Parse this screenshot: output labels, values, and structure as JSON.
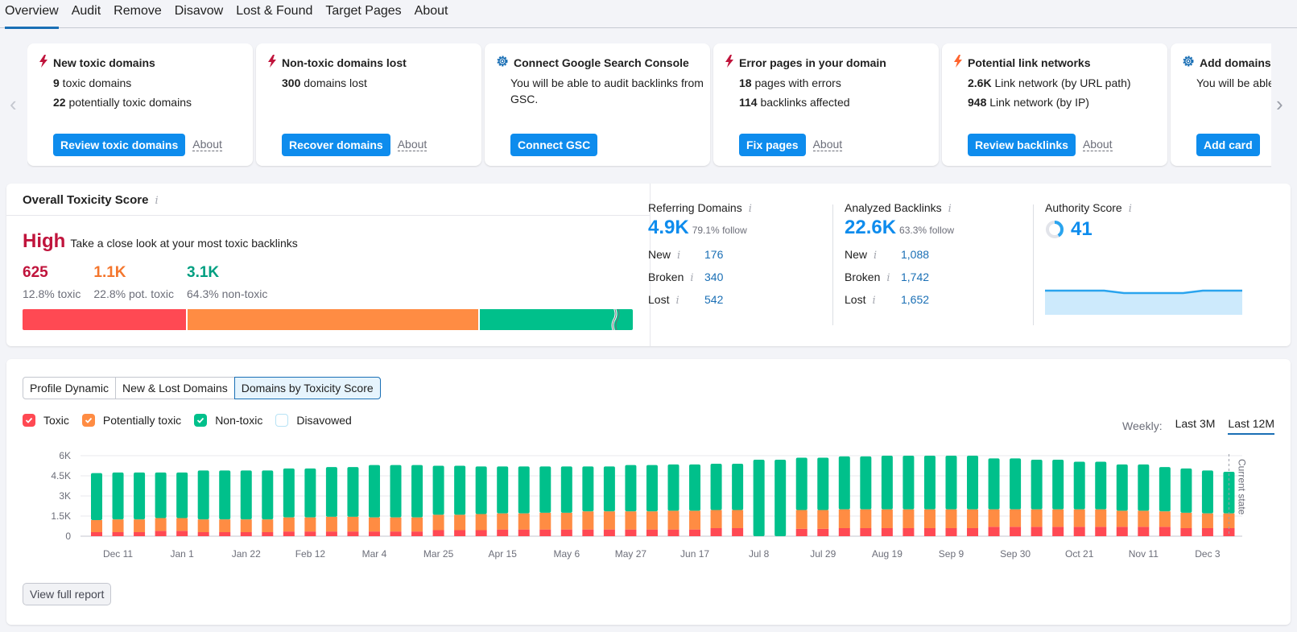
{
  "tabs": [
    {
      "label": "Overview",
      "active": true
    },
    {
      "label": "Audit"
    },
    {
      "label": "Remove"
    },
    {
      "label": "Disavow"
    },
    {
      "label": "Lost & Found"
    },
    {
      "label": "Target Pages"
    },
    {
      "label": "About"
    }
  ],
  "cards": [
    {
      "icon": "bolt",
      "icon_color": "#c0143c",
      "title": "New toxic domains",
      "lines": [
        {
          "num": "9",
          "text": " toxic domains"
        },
        {
          "num": "22",
          "text": " potentially toxic domains"
        }
      ],
      "button": "Review toxic domains",
      "about": "About"
    },
    {
      "icon": "bolt",
      "icon_color": "#c0143c",
      "title": "Non-toxic domains lost",
      "lines": [
        {
          "num": "300",
          "text": " domains lost"
        }
      ],
      "button": "Recover domains",
      "about": "About"
    },
    {
      "icon": "gear",
      "icon_color": "#1a6fb5",
      "title": "Connect Google Search Console",
      "desc": "You will be able to audit backlinks from GSC.",
      "button": "Connect GSC"
    },
    {
      "icon": "bolt",
      "icon_color": "#c0143c",
      "title": "Error pages in your domain",
      "lines": [
        {
          "num": "18",
          "text": " pages with errors"
        },
        {
          "num": "114",
          "text": " backlinks affected"
        }
      ],
      "button": "Fix pages",
      "about": "About"
    },
    {
      "icon": "bolt",
      "icon_color": "#ff642d",
      "title": "Potential link networks",
      "lines": [
        {
          "num": "2.6K",
          "text": " Link network (by URL path)"
        },
        {
          "num": "948",
          "text": " Link network (by IP)"
        }
      ],
      "button": "Review backlinks",
      "about": "About"
    },
    {
      "icon": "gear",
      "icon_color": "#1a6fb5",
      "title": "Add domains",
      "desc": "You will be able to add domains",
      "button": "Add card"
    }
  ],
  "toxicity": {
    "title": "Overall Toxicity Score",
    "info": "i",
    "level": "High",
    "level_text": "Take a close look at your most toxic backlinks",
    "stats": [
      {
        "num": "625",
        "label": "12.8% toxic",
        "color": "#c0143c",
        "share": 12.8,
        "bar_color": "#ff4953"
      },
      {
        "num": "1.1K",
        "label": "22.8% pot. toxic",
        "color": "#f4762d",
        "share": 22.8,
        "bar_color": "#ff8c43"
      },
      {
        "num": "3.1K",
        "label": "64.3% non-toxic",
        "color": "#009f81",
        "share": 64.3,
        "bar_color": "#00c08b"
      }
    ]
  },
  "metrics": {
    "referring": {
      "title": "Referring Domains",
      "value": "4.9K",
      "follow": "79.1% follow",
      "rows": [
        {
          "k": "New",
          "v": "176"
        },
        {
          "k": "Broken",
          "v": "340"
        },
        {
          "k": "Lost",
          "v": "542"
        }
      ]
    },
    "backlinks": {
      "title": "Analyzed Backlinks",
      "value": "22.6K",
      "follow": "63.3% follow",
      "rows": [
        {
          "k": "New",
          "v": "1,088"
        },
        {
          "k": "Broken",
          "v": "1,742"
        },
        {
          "k": "Lost",
          "v": "1,652"
        }
      ]
    },
    "authority": {
      "title": "Authority Score",
      "value": "41",
      "score_fraction": 0.41,
      "trend": [
        41,
        41,
        41,
        41,
        40,
        40,
        40,
        40,
        41,
        41,
        41
      ]
    }
  },
  "chart_section": {
    "views": [
      {
        "label": "Profile Dynamic"
      },
      {
        "label": "New & Lost Domains"
      },
      {
        "label": "Domains by Toxicity Score",
        "active": true
      }
    ],
    "legend": [
      {
        "label": "Toxic",
        "color": "#ff4953",
        "checked": true
      },
      {
        "label": "Potentially toxic",
        "color": "#ff8c43",
        "checked": true
      },
      {
        "label": "Non-toxic",
        "color": "#00c08b",
        "checked": true
      },
      {
        "label": "Disavowed",
        "color": "#b7e3f5",
        "checked": false
      }
    ],
    "period_label": "Weekly:",
    "periods": [
      {
        "label": "Last 3M"
      },
      {
        "label": "Last 12M",
        "active": true
      }
    ],
    "current_state_label": "Current state",
    "view_full_report": "View full report"
  },
  "chart_data": {
    "type": "bar",
    "stacked": true,
    "title": "Domains by Toxicity Score",
    "xlabel": "",
    "ylabel": "",
    "ylim": [
      0,
      6000
    ],
    "yticks": [
      0,
      1500,
      3000,
      4500,
      6000
    ],
    "ytick_labels": [
      "0",
      "1.5K",
      "3K",
      "4.5K",
      "6K"
    ],
    "xtick_labels": [
      "Dec 11",
      "Jan 1",
      "Jan 22",
      "Feb 12",
      "Mar 4",
      "Mar 25",
      "Apr 15",
      "May 6",
      "May 27",
      "Jun 17",
      "Jul 8",
      "Jul 29",
      "Aug 19",
      "Sep 9",
      "Sep 30",
      "Oct 21",
      "Nov 11",
      "Dec 3"
    ],
    "grid": true,
    "series": [
      {
        "name": "Toxic",
        "color": "#ff4953",
        "values": [
          300,
          300,
          300,
          400,
          400,
          300,
          300,
          300,
          300,
          350,
          350,
          350,
          350,
          350,
          350,
          350,
          450,
          450,
          450,
          500,
          500,
          500,
          500,
          500,
          500,
          500,
          500,
          500,
          500,
          600,
          600,
          0,
          0,
          550,
          550,
          600,
          600,
          600,
          600,
          600,
          600,
          600,
          700,
          700,
          700,
          700,
          700,
          700,
          700,
          700,
          700,
          600,
          600,
          600
        ]
      },
      {
        "name": "Potentially toxic",
        "color": "#ff8c43",
        "values": [
          900,
          950,
          950,
          950,
          950,
          950,
          950,
          950,
          950,
          1050,
          1050,
          1100,
          1100,
          1050,
          1050,
          1050,
          1150,
          1150,
          1200,
          1200,
          1200,
          1250,
          1250,
          1350,
          1350,
          1350,
          1350,
          1400,
          1400,
          1350,
          1350,
          0,
          0,
          1400,
          1400,
          1400,
          1400,
          1400,
          1400,
          1400,
          1400,
          1400,
          1300,
          1300,
          1300,
          1300,
          1300,
          1300,
          1200,
          1200,
          1150,
          1150,
          1100,
          1100
        ]
      },
      {
        "name": "Non-toxic",
        "color": "#00c08b",
        "values": [
          3500,
          3500,
          3500,
          3400,
          3400,
          3650,
          3650,
          3650,
          3650,
          3650,
          3650,
          3700,
          3700,
          3900,
          3900,
          3900,
          3650,
          3650,
          3550,
          3500,
          3500,
          3450,
          3450,
          3350,
          3350,
          3450,
          3450,
          3450,
          3450,
          3450,
          3450,
          5700,
          5700,
          3900,
          3900,
          3950,
          3950,
          4000,
          4000,
          4000,
          4000,
          4000,
          3800,
          3800,
          3700,
          3700,
          3550,
          3550,
          3450,
          3450,
          3300,
          3300,
          3200,
          3100
        ]
      },
      {
        "name": "Disavowed",
        "color": "#b7e3f5",
        "values": []
      }
    ]
  }
}
